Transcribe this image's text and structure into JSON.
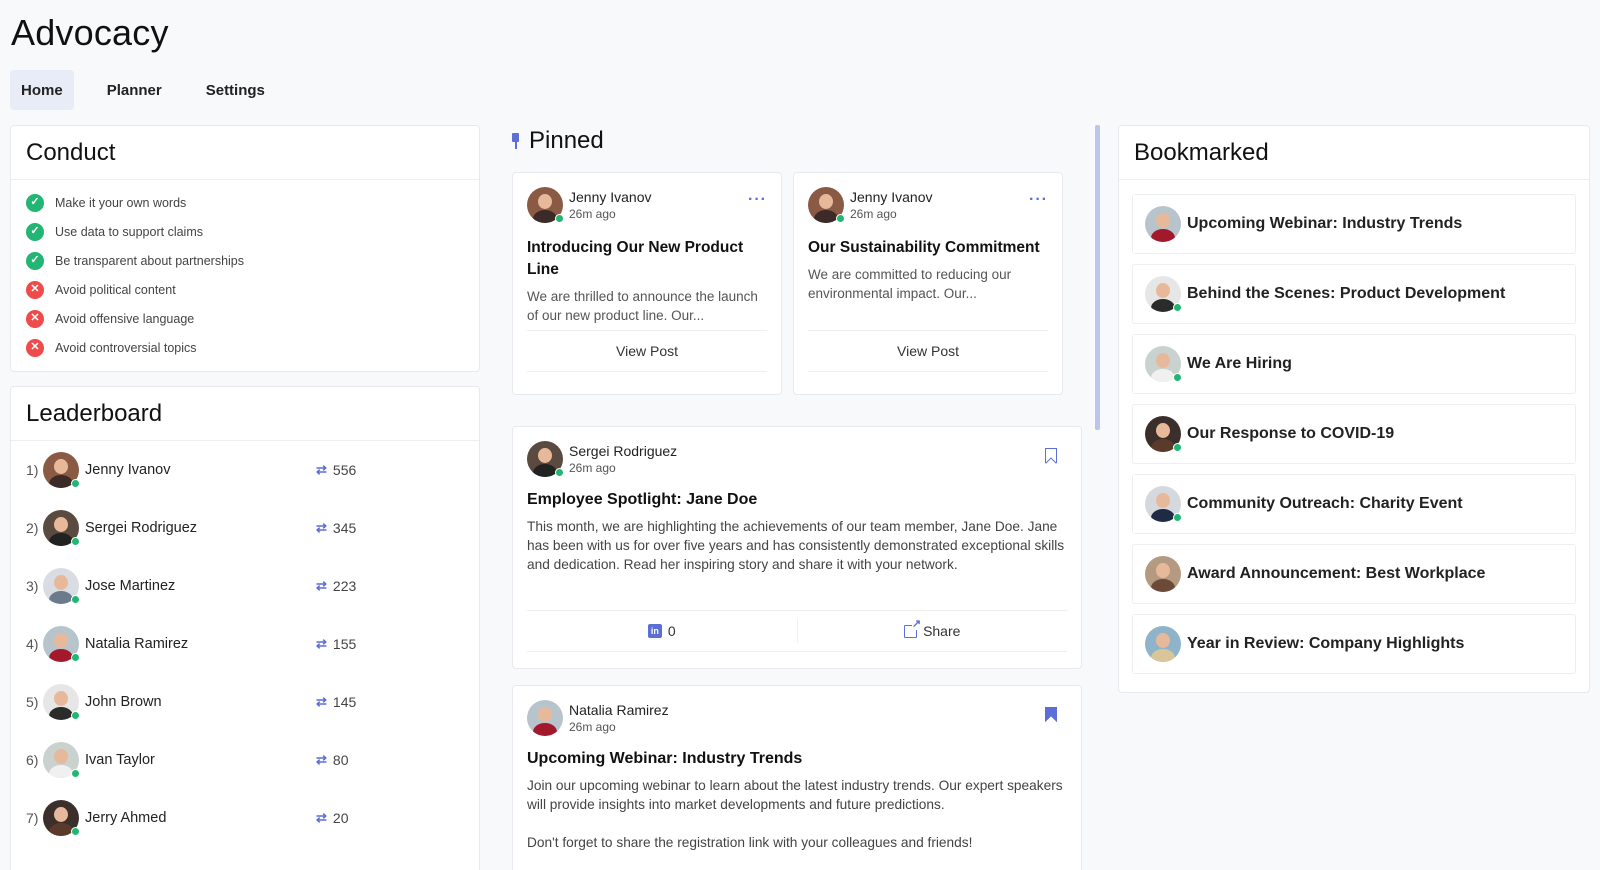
{
  "app": {
    "title": "Advocacy"
  },
  "tabs": [
    {
      "label": "Home",
      "active": true
    },
    {
      "label": "Planner",
      "active": false
    },
    {
      "label": "Settings",
      "active": false
    }
  ],
  "conduct": {
    "title": "Conduct",
    "rules": [
      {
        "text": "Make it your own words",
        "status": "allowed",
        "icon": "check-circle-icon"
      },
      {
        "text": "Use data to support claims",
        "status": "allowed",
        "icon": "check-circle-icon"
      },
      {
        "text": "Be transparent about partnerships",
        "status": "allowed",
        "icon": "check-circle-icon"
      },
      {
        "text": "Avoid political content",
        "status": "forbidden",
        "icon": "x-circle-icon"
      },
      {
        "text": "Avoid offensive language",
        "status": "forbidden",
        "icon": "x-circle-icon"
      },
      {
        "text": "Avoid controversial topics",
        "status": "forbidden",
        "icon": "x-circle-icon"
      }
    ]
  },
  "leaderboard": {
    "title": "Leaderboard",
    "rows": [
      {
        "rank": "1)",
        "name": "Jenny Ivanov",
        "score": "556"
      },
      {
        "rank": "2)",
        "name": "Sergei Rodriguez",
        "score": "345"
      },
      {
        "rank": "3)",
        "name": "Jose Martinez",
        "score": "223"
      },
      {
        "rank": "4)",
        "name": "Natalia Ramirez",
        "score": "155"
      },
      {
        "rank": "5)",
        "name": "John Brown",
        "score": "145"
      },
      {
        "rank": "6)",
        "name": "Ivan Taylor",
        "score": "80"
      },
      {
        "rank": "7)",
        "name": "Jerry Ahmed",
        "score": "20"
      }
    ]
  },
  "pinned": {
    "title": "Pinned",
    "posts": [
      {
        "author": "Jenny Ivanov",
        "time": "26m ago",
        "title": "Introducing Our New Product Line",
        "body": "We are thrilled to announce the launch of our new product line. Our...",
        "action": "View Post"
      },
      {
        "author": "Jenny Ivanov",
        "time": "26m ago",
        "title": "Our Sustainability Commitment",
        "body": "We are committed to reducing our environmental impact. Our...",
        "action": "View Post"
      }
    ]
  },
  "feed": [
    {
      "author": "Sergei Rodriguez",
      "time": "26m ago",
      "bookmarked": false,
      "title": "Employee Spotlight: Jane Doe",
      "body": "This month, we are highlighting the achievements of our team member, Jane Doe. Jane has been with us for over five years and has consistently demonstrated exceptional skills and dedication. Read her inspiring story and share it with your network.",
      "linkedin_count": "0",
      "share_label": "Share"
    },
    {
      "author": "Natalia Ramirez",
      "time": "26m ago",
      "bookmarked": true,
      "title": "Upcoming Webinar: Industry Trends",
      "body": "Join our upcoming webinar to learn about the latest industry trends. Our expert speakers will provide insights into market developments and future predictions.\n\nDon't forget to share the registration link with your colleagues and friends!"
    }
  ],
  "bookmarked": {
    "title": "Bookmarked",
    "items": [
      {
        "label": "Upcoming Webinar: Industry Trends"
      },
      {
        "label": "Behind the Scenes: Product Development"
      },
      {
        "label": "We Are Hiring"
      },
      {
        "label": "Our Response to COVID-19"
      },
      {
        "label": "Community Outreach: Charity Event"
      },
      {
        "label": "Award Announcement: Best Workplace"
      },
      {
        "label": "Year in Review: Company Highlights"
      }
    ]
  },
  "colors": {
    "accent": "#5b6fd6",
    "success": "#22b573",
    "danger": "#ef4b4b",
    "online": "#22b573"
  }
}
